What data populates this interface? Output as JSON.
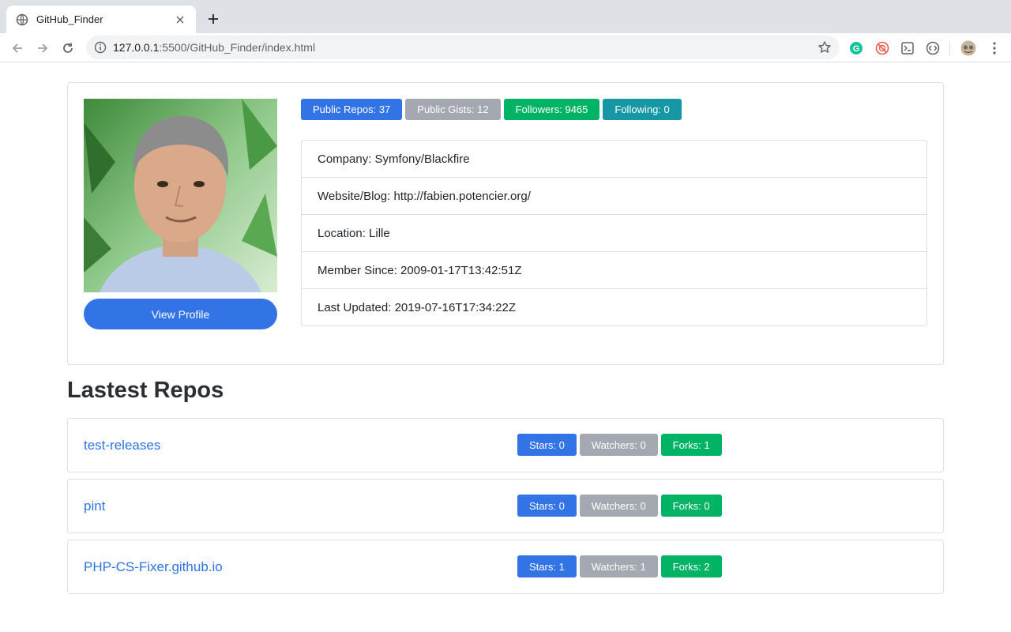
{
  "browser": {
    "tab_title": "GitHub_Finder",
    "url_host": "127.0.0.1",
    "url_path": ":5500/GitHub_Finder/index.html"
  },
  "profile": {
    "view_profile_label": "View Profile",
    "badges": {
      "public_repos": "Public Repos: 37",
      "public_gists": "Public Gists: 12",
      "followers": "Followers: 9465",
      "following": "Following: 0"
    },
    "info": [
      "Company: Symfony/Blackfire",
      "Website/Blog: http://fabien.potencier.org/",
      "Location: Lille",
      "Member Since: 2009-01-17T13:42:51Z",
      "Last Updated: 2019-07-16T17:34:22Z"
    ]
  },
  "repos_title": "Lastest Repos",
  "repos": [
    {
      "name": "test-releases",
      "stars": "Stars: 0",
      "watchers": "Watchers: 0",
      "forks": "Forks: 1"
    },
    {
      "name": "pint",
      "stars": "Stars: 0",
      "watchers": "Watchers: 0",
      "forks": "Forks: 0"
    },
    {
      "name": "PHP-CS-Fixer.github.io",
      "stars": "Stars: 1",
      "watchers": "Watchers: 1",
      "forks": "Forks: 2"
    }
  ],
  "colors": {
    "primary": "#3273e6",
    "secondary": "#a4a8b0",
    "success": "#00b365",
    "info": "#1597a5",
    "link": "#2d74e5"
  }
}
